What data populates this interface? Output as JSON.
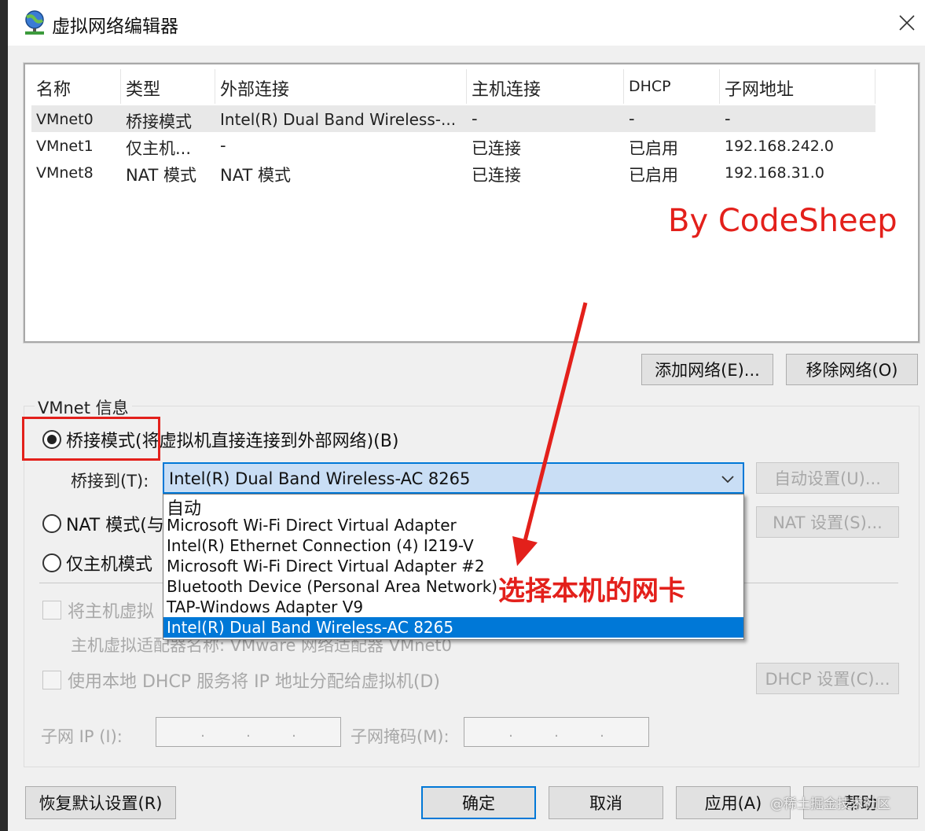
{
  "window": {
    "title": "虚拟网络编辑器"
  },
  "table": {
    "columns": [
      "名称",
      "类型",
      "外部连接",
      "主机连接",
      "DHCP",
      "子网地址"
    ],
    "rows": [
      [
        "VMnet0",
        "桥接模式",
        "Intel(R) Dual Band Wireless-...",
        "-",
        "-",
        "-"
      ],
      [
        "VMnet1",
        "仅主机...",
        "-",
        "已连接",
        "已启用",
        "192.168.242.0"
      ],
      [
        "VMnet8",
        "NAT 模式",
        "NAT 模式",
        "已连接",
        "已启用",
        "192.168.31.0"
      ]
    ]
  },
  "watermark_codesheep": "By CodeSheep",
  "buttons": {
    "add_network": "添加网络(E)...",
    "remove_network": "移除网络(O)",
    "auto_settings": "自动设置(U)...",
    "nat_settings": "NAT 设置(S)...",
    "dhcp_settings": "DHCP 设置(C)...",
    "restore_defaults": "恢复默认设置(R)",
    "ok": "确定",
    "cancel": "取消",
    "apply": "应用(A)",
    "help": "帮助"
  },
  "vmnet_info": {
    "group_label": "VMnet 信息",
    "bridge_mode": "桥接模式(将虚拟机直接连接到外部网络)(B)",
    "bridge_to_label": "桥接到(T):",
    "bridge_to_value": "Intel(R) Dual Band Wireless-AC 8265",
    "nat_mode": "NAT 模式(与",
    "host_only_mode": "仅主机模式",
    "connect_host_adapter": "将主机虚拟",
    "host_adapter_name": "主机虚拟适配器名称: VMware 网络适配器 VMnet0",
    "use_local_dhcp": "使用本地 DHCP 服务将 IP 地址分配给虚拟机(D)",
    "subnet_ip_label": "子网 IP (I):",
    "subnet_mask_label": "子网掩码(M):"
  },
  "dropdown_options": [
    "自动",
    "Microsoft Wi-Fi Direct Virtual Adapter",
    "Intel(R) Ethernet Connection (4) I219-V",
    "Microsoft Wi-Fi Direct Virtual Adapter #2",
    "Bluetooth Device (Personal Area Network)",
    "TAP-Windows Adapter V9",
    "Intel(R) Dual Band Wireless-AC 8265"
  ],
  "annotation_text": "选择本机的网卡",
  "credit": "@稀土掘金技术社区",
  "colors": {
    "annotation_red": "#e3201b",
    "selection_blue": "#0078d7"
  }
}
